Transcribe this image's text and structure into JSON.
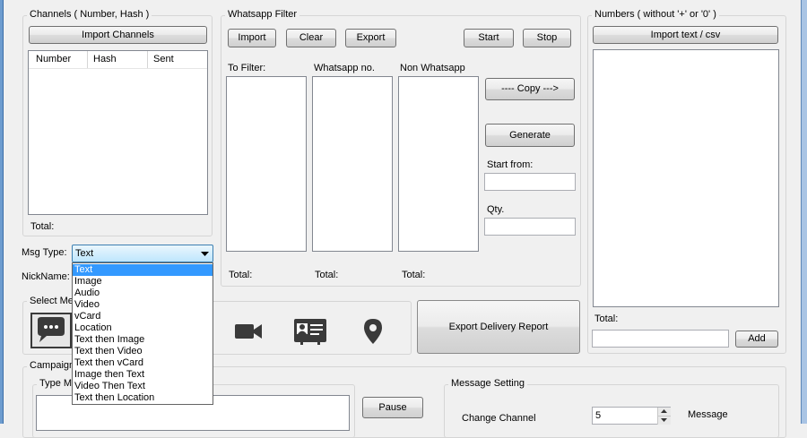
{
  "channels": {
    "title": "Channels ( Number, Hash )",
    "import_label": "Import Channels",
    "columns": [
      "Number",
      "Hash",
      "Sent"
    ],
    "total_label": "Total:"
  },
  "msg_type": {
    "label": "Msg Type:",
    "selected": "Text",
    "options": [
      "Text",
      "Image",
      "Audio",
      "Video",
      "vCard",
      "Location",
      "Text then Image",
      "Text then Video",
      "Text then vCard",
      "Image then Text",
      "Video Then Text",
      "Text then Location"
    ]
  },
  "nickname": {
    "label": "NickName:"
  },
  "select_media": {
    "title": "Select Me"
  },
  "whatsapp_filter": {
    "title": "Whatsapp Filter",
    "import_label": "Import",
    "clear_label": "Clear",
    "export_label": "Export",
    "start_label": "Start",
    "stop_label": "Stop",
    "to_filter_label": "To Filter:",
    "whatsapp_no_label": "Whatsapp no.",
    "non_whatsapp_label": "Non Whatsapp",
    "copy_label": "---- Copy --->",
    "generate_label": "Generate",
    "start_from_label": "Start from:",
    "qty_label": "Qty.",
    "total_label": "Total:"
  },
  "numbers": {
    "title": "Numbers ( without '+' or '0' )",
    "import_label": "Import text / csv",
    "total_label": "Total:",
    "add_label": "Add"
  },
  "export_report_label": "Export Delivery Report",
  "campaign": {
    "title": "Campaign",
    "type_message_title": "Type M",
    "pause_label": "Pause"
  },
  "message_setting": {
    "title": "Message Setting",
    "change_channel_label": "Change Channel",
    "change_channel_value": "5",
    "message_label": "Message"
  },
  "icons": [
    "chat-icon",
    "video-camera-icon",
    "contact-card-icon",
    "location-pin-icon"
  ]
}
